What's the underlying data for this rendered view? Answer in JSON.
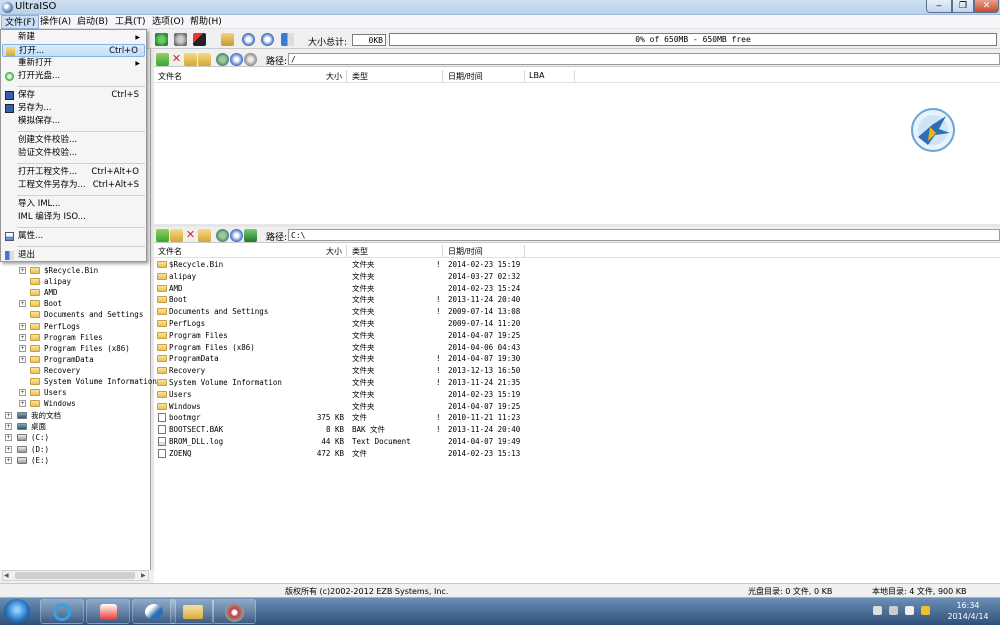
{
  "window": {
    "title": "UltraISO"
  },
  "menubar": {
    "items": [
      "文件(F)",
      "操作(A)",
      "启动(B)",
      "工具(T)",
      "选项(O)",
      "帮助(H)"
    ]
  },
  "toolbar": {
    "size_label": "大小总计:",
    "size_value": "0KB",
    "capacity_text": "0% of 650MB - 650MB free"
  },
  "file_menu": {
    "items": [
      {
        "label": "新建",
        "shortcut": "",
        "submenu": true
      },
      {
        "label": "打开...",
        "shortcut": "Ctrl+O",
        "submenu": false
      },
      {
        "label": "重新打开",
        "shortcut": "",
        "submenu": true
      },
      {
        "label": "打开光盘...",
        "shortcut": "",
        "submenu": false
      },
      {
        "label": "保存",
        "shortcut": "Ctrl+S",
        "submenu": false
      },
      {
        "label": "另存为...",
        "shortcut": "",
        "submenu": false
      },
      {
        "label": "模拟保存...",
        "shortcut": "",
        "submenu": false
      },
      {
        "label": "创建文件校验...",
        "shortcut": "",
        "submenu": false
      },
      {
        "label": "验证文件校验...",
        "shortcut": "",
        "submenu": false
      },
      {
        "label": "打开工程文件...",
        "shortcut": "Ctrl+Alt+O",
        "submenu": false
      },
      {
        "label": "工程文件另存为...",
        "shortcut": "Ctrl+Alt+S",
        "submenu": false
      },
      {
        "label": "导入 IML...",
        "shortcut": "",
        "submenu": false
      },
      {
        "label": "IML 编译为 ISO...",
        "shortcut": "",
        "submenu": false
      },
      {
        "label": "属性...",
        "shortcut": "",
        "submenu": false
      },
      {
        "label": "退出",
        "shortcut": "",
        "submenu": false
      }
    ]
  },
  "iso_pane": {
    "path_label": "路径:",
    "path_value": "/",
    "columns": [
      "文件名",
      "大小",
      "类型",
      "日期/时间",
      "LBA"
    ]
  },
  "local_pane": {
    "path_label": "路径:",
    "path_value": "C:\\",
    "columns": [
      "文件名",
      "大小",
      "类型",
      "日期/时间"
    ],
    "rows": [
      {
        "name": "$Recycle.Bin",
        "size": "",
        "type": "文件夹",
        "flag": "!",
        "date": "2014-02-23 15:19",
        "kind": "folder"
      },
      {
        "name": "alipay",
        "size": "",
        "type": "文件夹",
        "flag": "",
        "date": "2014-03-27 02:32",
        "kind": "folder"
      },
      {
        "name": "AMD",
        "size": "",
        "type": "文件夹",
        "flag": "",
        "date": "2014-02-23 15:24",
        "kind": "folder"
      },
      {
        "name": "Boot",
        "size": "",
        "type": "文件夹",
        "flag": "!",
        "date": "2013-11-24 20:40",
        "kind": "folder"
      },
      {
        "name": "Documents and Settings",
        "size": "",
        "type": "文件夹",
        "flag": "!",
        "date": "2009-07-14 13:08",
        "kind": "folder"
      },
      {
        "name": "PerfLogs",
        "size": "",
        "type": "文件夹",
        "flag": "",
        "date": "2009-07-14 11:20",
        "kind": "folder"
      },
      {
        "name": "Program Files",
        "size": "",
        "type": "文件夹",
        "flag": "",
        "date": "2014-04-07 19:25",
        "kind": "folder"
      },
      {
        "name": "Program Files (x86)",
        "size": "",
        "type": "文件夹",
        "flag": "",
        "date": "2014-04-06 04:43",
        "kind": "folder"
      },
      {
        "name": "ProgramData",
        "size": "",
        "type": "文件夹",
        "flag": "!",
        "date": "2014-04-07 19:30",
        "kind": "folder"
      },
      {
        "name": "Recovery",
        "size": "",
        "type": "文件夹",
        "flag": "!",
        "date": "2013-12-13 16:50",
        "kind": "folder"
      },
      {
        "name": "System Volume Information",
        "size": "",
        "type": "文件夹",
        "flag": "!",
        "date": "2013-11-24 21:35",
        "kind": "folder"
      },
      {
        "name": "Users",
        "size": "",
        "type": "文件夹",
        "flag": "",
        "date": "2014-02-23 15:19",
        "kind": "folder"
      },
      {
        "name": "Windows",
        "size": "",
        "type": "文件夹",
        "flag": "",
        "date": "2014-04-07 19:25",
        "kind": "folder"
      },
      {
        "name": "bootmgr",
        "size": "375 KB",
        "type": "文件",
        "flag": "!",
        "date": "2010-11-21 11:23",
        "kind": "file"
      },
      {
        "name": "BOOTSECT.BAK",
        "size": "8 KB",
        "type": "BAK 文件",
        "flag": "!",
        "date": "2013-11-24 20:40",
        "kind": "file"
      },
      {
        "name": "BROM_DLL.log",
        "size": "44 KB",
        "type": "Text Document",
        "flag": "",
        "date": "2014-04-07 19:49",
        "kind": "txt"
      },
      {
        "name": "ZOENQ",
        "size": "472 KB",
        "type": "文件",
        "flag": "",
        "date": "2014-02-23 15:13",
        "kind": "file"
      }
    ]
  },
  "tree": {
    "children": [
      "$Recycle.Bin",
      "alipay",
      "AMD",
      "Boot",
      "Documents and Settings",
      "PerfLogs",
      "Program Files",
      "Program Files (x86)",
      "ProgramData",
      "Recovery",
      "System Volume Information",
      "Users",
      "Windows"
    ],
    "children_expandable": [
      true,
      false,
      false,
      true,
      false,
      true,
      true,
      true,
      true,
      false,
      false,
      true,
      true
    ],
    "roots": [
      "我的文档",
      "桌面",
      "(C:)",
      "(D:)",
      "(E:)"
    ]
  },
  "statusbar": {
    "copyright": "版权所有 (c)2002-2012 EZB Systems, Inc.",
    "disc_label": "光盘目录: 0 文件, 0 KB",
    "local_label": "本地目录: 4 文件, 900 KB"
  },
  "taskbar": {
    "time": "16:34",
    "date": "2014/4/14"
  },
  "colors": {
    "title": "#b9d1ea",
    "menu_highlight": "#c4dcf5",
    "folder": "#f4d27a",
    "taskbar": "#2e4f78"
  },
  "icons": [
    "new-icon",
    "open-icon",
    "extract-icon",
    "save-icon",
    "properties-icon",
    "help-icon",
    "exit-icon",
    "up-folder-icon",
    "delete-icon",
    "new-folder-icon",
    "ultraiso-logo-icon"
  ]
}
